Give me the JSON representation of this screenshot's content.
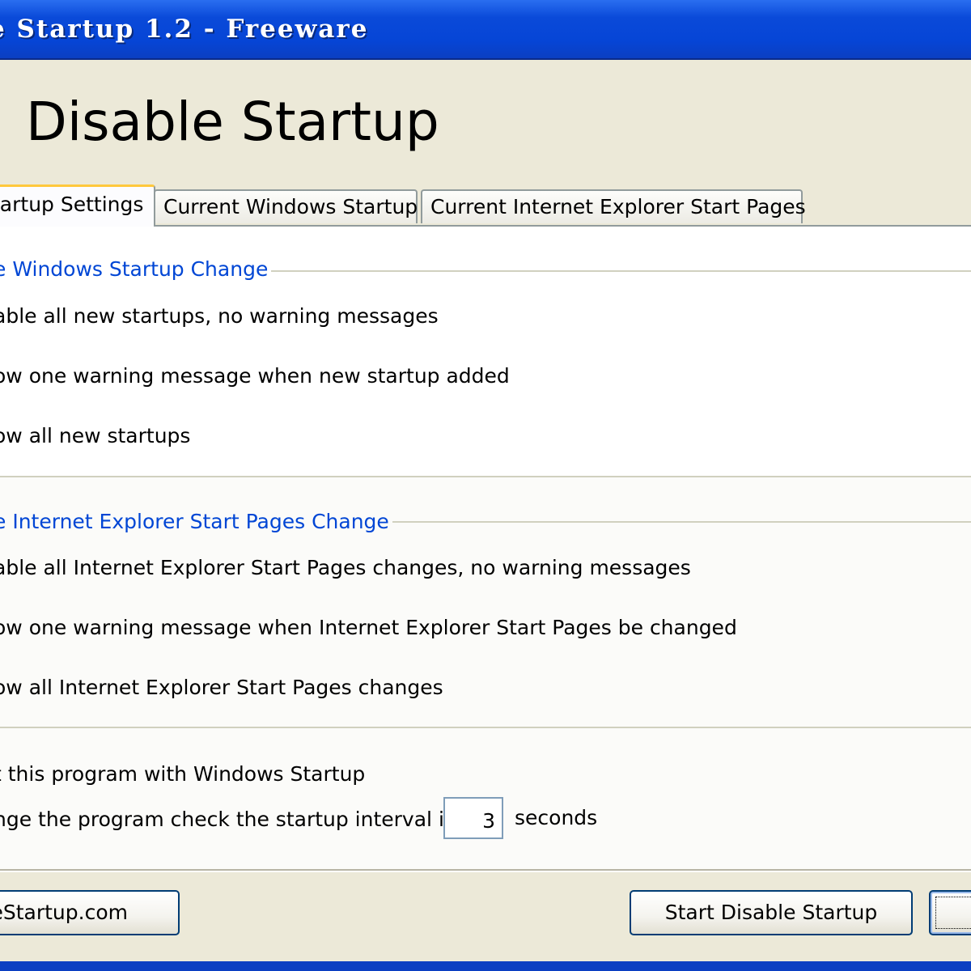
{
  "window": {
    "title": "e Startup 1.2 - Freeware"
  },
  "header": {
    "app_title": "Disable Startup"
  },
  "tabs": [
    {
      "label": "tartup Settings",
      "active": true
    },
    {
      "label": "Current Windows Startup",
      "active": false
    },
    {
      "label": "Current Internet Explorer Start Pages",
      "active": false
    }
  ],
  "windows_group": {
    "label": "e Windows Startup Change",
    "options": [
      "able all new startups, no warning messages",
      "ow one warning message when new startup added",
      "ow all new startups"
    ]
  },
  "ie_group": {
    "label": "e Internet Explorer Start Pages Change",
    "options": [
      "able all Internet Explorer Start Pages changes, no warning messages",
      "ow one warning message when Internet Explorer Start Pages be changed",
      "ow all Internet Explorer Start Pages changes"
    ]
  },
  "settings": {
    "start_with_windows": "t this program with Windows Startup",
    "interval_prefix": "nge the program check the startup interval in",
    "interval_value": "3",
    "interval_suffix": "seconds"
  },
  "buttons": {
    "website": "eStartup.com",
    "start": "Start Disable Startup",
    "next": ""
  },
  "colors": {
    "titlebar": "#0645d6",
    "group_label": "#0046d5",
    "tab_highlight": "#ffc83c",
    "window_bg": "#ece9d8"
  }
}
